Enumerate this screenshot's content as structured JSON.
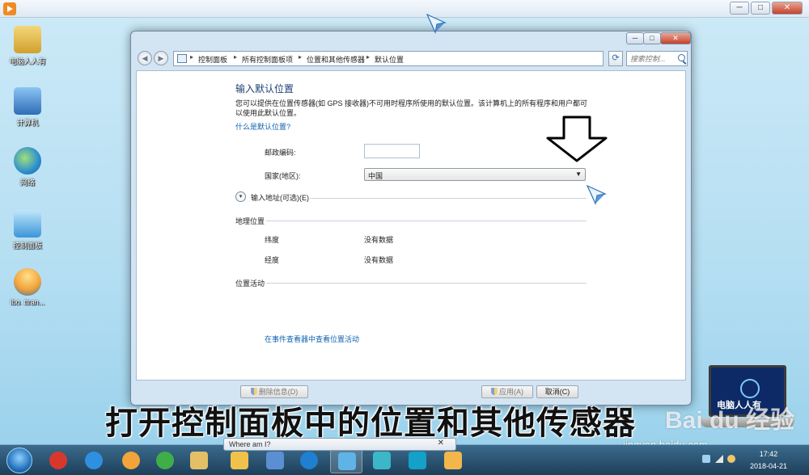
{
  "outer": {
    "minimize": "─",
    "maximize": "□",
    "close": "✕"
  },
  "desktop": {
    "icons": [
      {
        "label": "电脑人人有",
        "color": "#e9c04a"
      },
      {
        "label": "计算机",
        "color": "#4b8fd6"
      },
      {
        "label": "网络",
        "color": "#3aa0dc"
      },
      {
        "label": "控制面板",
        "color": "#5fb3e6"
      },
      {
        "label": "lbq_ttran...",
        "color": "#f2a43a"
      }
    ]
  },
  "window": {
    "minimize": "─",
    "maximize": "□",
    "close": "✕",
    "back_icon": "back-arrow-icon",
    "breadcrumbs": [
      "控制面板",
      "所有控制面板项",
      "位置和其他传感器",
      "默认位置"
    ],
    "search_placeholder": "搜索控制...",
    "refresh_icon": "⟳",
    "dropdown_icon": "▾"
  },
  "content": {
    "title": "输入默认位置",
    "description": "您可以提供在位置传感器(如 GPS 接收器)不可用时程序所使用的默认位置。该计算机上的所有程序和用户都可以使用此默认位置。",
    "what_link": "什么是默认位置?",
    "postal_label": "邮政编码:",
    "postal_value": "",
    "country_label": "国家(地区):",
    "country_value": "中国",
    "address_toggle": "输入地址(可选)(E)",
    "geo_section": "地理位置",
    "latitude_label": "纬度",
    "latitude_value": "没有数据",
    "longitude_label": "经度",
    "longitude_value": "没有数据",
    "activity_section": "位置活动",
    "event_link": "在事件查看器中查看位置活动"
  },
  "buttons": {
    "delete": "删除信息(D)",
    "apply": "应用(A)",
    "cancel": "取消(C)"
  },
  "overlay": {
    "caption": "打开控制面板中的位置和其他传感器",
    "watermark": "Bai du 经验",
    "watermark_url": "jingyan.baidu.com",
    "laptop_brand": "电脑人人有"
  },
  "taskbar": {
    "preview_title": "Where am I?",
    "preview_close": "✕",
    "apps": [
      {
        "name": "jiang-app",
        "color": "#d8382c"
      },
      {
        "name": "ie",
        "color": "#2f8fe0"
      },
      {
        "name": "media-player",
        "color": "#f2a43a"
      },
      {
        "name": "chrome",
        "color": "#3fae49"
      },
      {
        "name": "explorer",
        "color": "#e3c066"
      },
      {
        "name": "folder",
        "color": "#f0c24b"
      },
      {
        "name": "document",
        "color": "#5a8fd3"
      },
      {
        "name": "edge-like",
        "color": "#1f7fd0"
      },
      {
        "name": "control-panel",
        "color": "#5fb3e6"
      },
      {
        "name": "pinwheel",
        "color": "#3cb7c7"
      },
      {
        "name": "headset",
        "color": "#13a0c9"
      },
      {
        "name": "paint",
        "color": "#f3b64a"
      }
    ],
    "time": "17:42",
    "date": "2018-04-21"
  }
}
